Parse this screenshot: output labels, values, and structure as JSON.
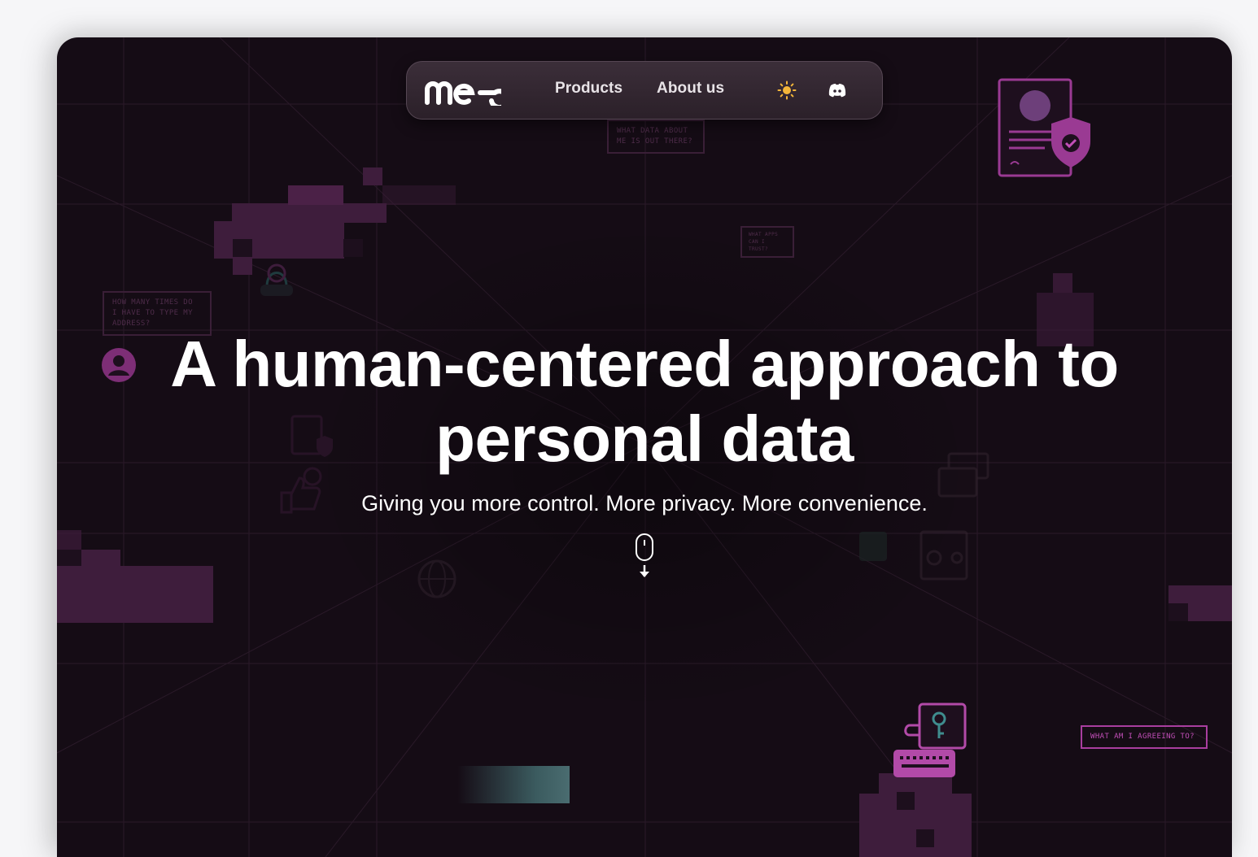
{
  "nav": {
    "logo_text": "mee",
    "links": [
      {
        "label": "Products"
      },
      {
        "label": "About us"
      }
    ],
    "theme_toggle_icon": "sun-icon",
    "community_icon": "discord-icon"
  },
  "hero": {
    "title_line1": "A human-centered approach to",
    "title_line2": "personal data",
    "subtitle": "Giving you more control. More privacy. More convenience.",
    "scroll_icon": "mouse-scroll-down-icon"
  },
  "bubbles": {
    "what_data": "WHAT DATA ABOUT ME IS OUT THERE?",
    "what_apps": "WHAT APPS CAN I TRUST?",
    "how_many": "HOW MANY TIMES DO I HAVE TO TYPE MY ADDRESS?",
    "agreeing": "WHAT AM I AGREEING TO?"
  },
  "colors": {
    "background": "#150c15",
    "accent": "#a93e9f",
    "nav_bg": "#2f2330",
    "text": "#ffffff"
  }
}
